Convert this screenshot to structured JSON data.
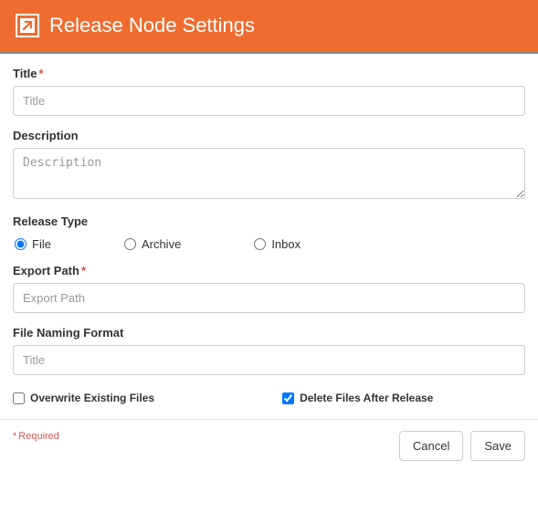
{
  "header": {
    "title": "Release Node Settings",
    "icon": "release-icon"
  },
  "fields": {
    "title": {
      "label": "Title",
      "required": true,
      "placeholder": "Title",
      "value": ""
    },
    "description": {
      "label": "Description",
      "required": false,
      "placeholder": "Description",
      "value": ""
    },
    "release_type": {
      "label": "Release Type",
      "options": [
        {
          "label": "File",
          "value": "file",
          "checked": true
        },
        {
          "label": "Archive",
          "value": "archive",
          "checked": false
        },
        {
          "label": "Inbox",
          "value": "inbox",
          "checked": false
        }
      ]
    },
    "export_path": {
      "label": "Export Path",
      "required": true,
      "placeholder": "Export Path",
      "value": ""
    },
    "file_naming_format": {
      "label": "File Naming Format",
      "required": false,
      "placeholder": "Title",
      "value": ""
    },
    "overwrite": {
      "label": "Overwrite Existing Files",
      "checked": false
    },
    "delete_after": {
      "label": "Delete Files After Release",
      "checked": true
    }
  },
  "footer": {
    "required_text": "Required",
    "cancel": "Cancel",
    "save": "Save"
  }
}
